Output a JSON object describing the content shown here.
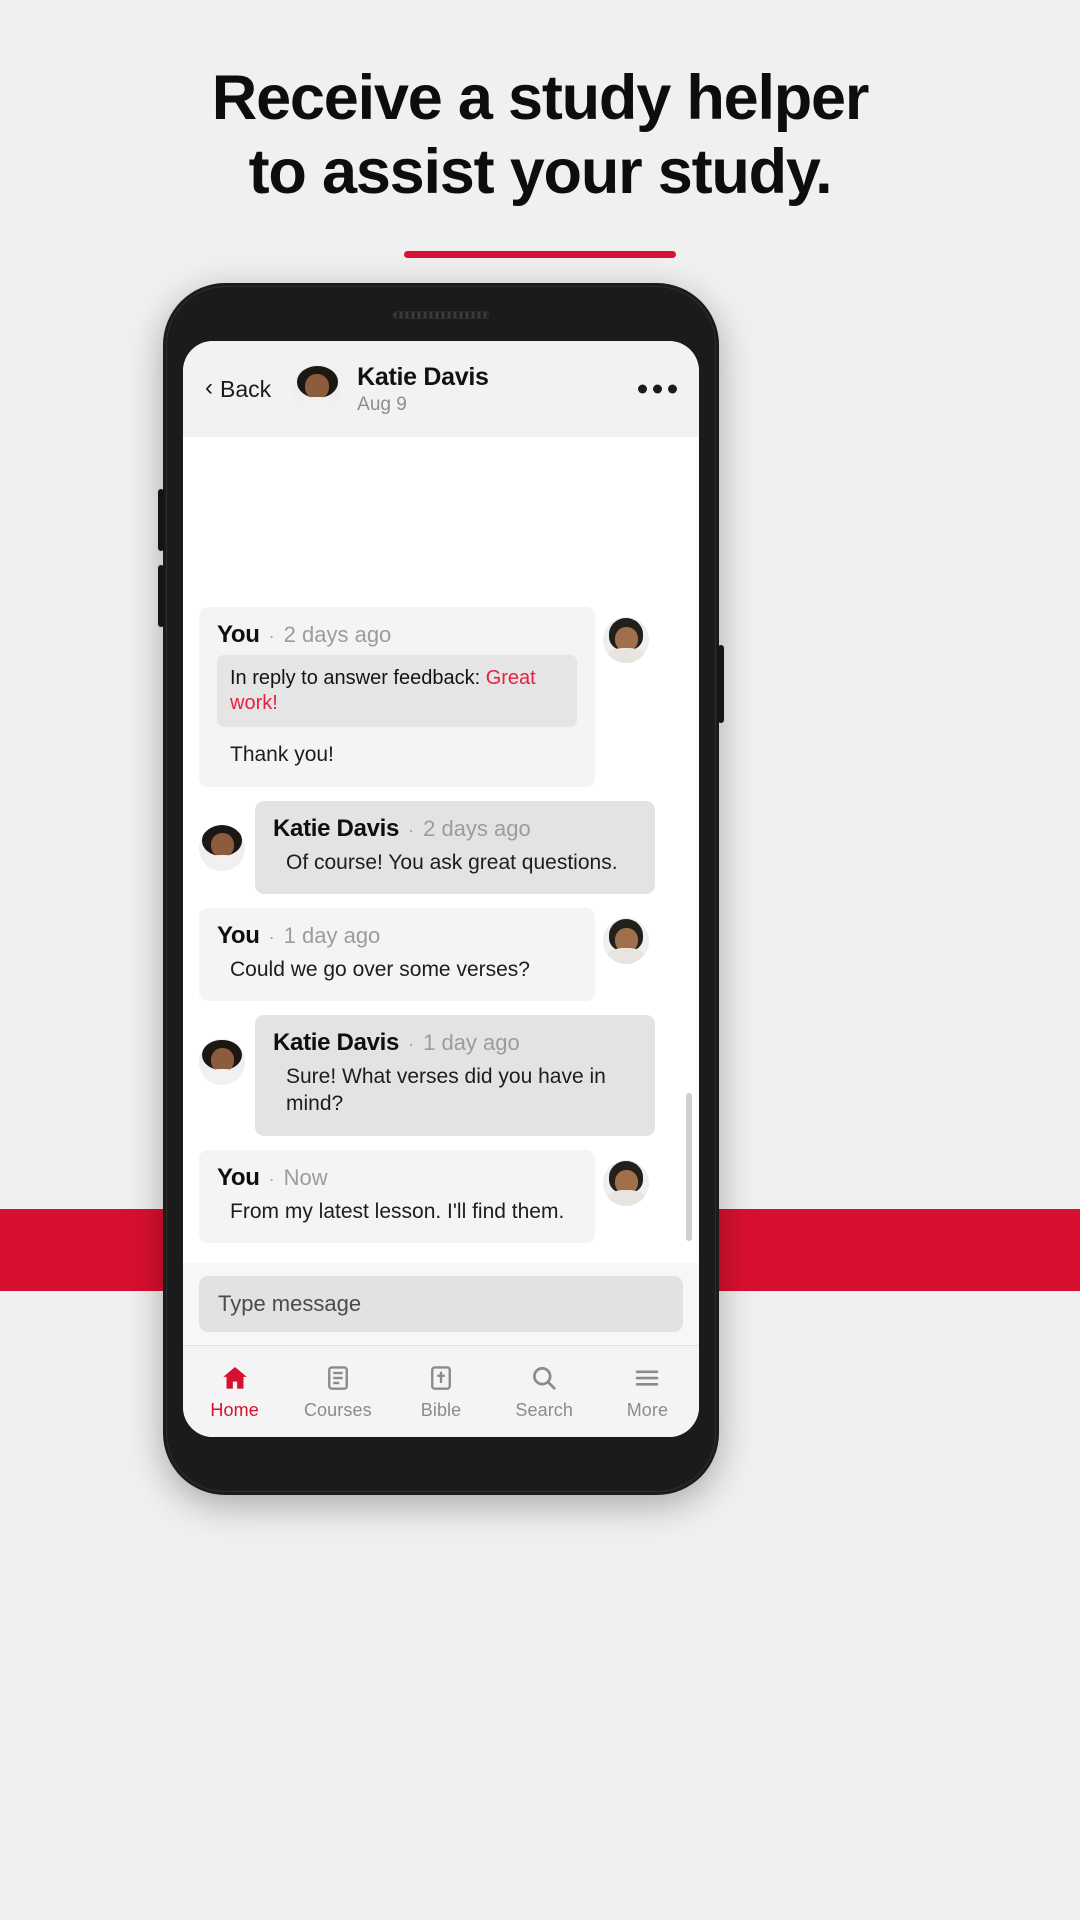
{
  "promo": {
    "headline_line1": "Receive a study helper",
    "headline_line2": "to assist your study.",
    "accent_color": "#d8102f"
  },
  "chat_header": {
    "back_label": "Back",
    "contact_name": "Katie Davis",
    "date": "Aug 9",
    "more_icon": "more-horizontal-icon"
  },
  "messages": [
    {
      "sender": "You",
      "time": "2 days ago",
      "side": "out",
      "quote_prefix": "In reply to answer feedback: ",
      "quote_highlight": "Great work!",
      "text": "Thank you!"
    },
    {
      "sender": "Katie Davis",
      "time": "2 days ago",
      "side": "in",
      "text": "Of course! You ask great questions."
    },
    {
      "sender": "You",
      "time": "1 day ago",
      "side": "out",
      "text": "Could we go over some verses?"
    },
    {
      "sender": "Katie Davis",
      "time": "1 day ago",
      "side": "in",
      "text": "Sure! What verses did you have in mind?"
    },
    {
      "sender": "You",
      "time": "Now",
      "side": "out",
      "text": "From my latest lesson. I'll find them."
    }
  ],
  "separator_dot": "·",
  "composer": {
    "placeholder": "Type message"
  },
  "bottom_nav": {
    "items": [
      {
        "label": "Home",
        "icon": "home-icon",
        "active": true
      },
      {
        "label": "Courses",
        "icon": "book-icon",
        "active": false
      },
      {
        "label": "Bible",
        "icon": "bible-icon",
        "active": false
      },
      {
        "label": "Search",
        "icon": "search-icon",
        "active": false
      },
      {
        "label": "More",
        "icon": "menu-icon",
        "active": false
      }
    ],
    "active_color": "#d8102f",
    "inactive_color": "#8b8b8b"
  }
}
